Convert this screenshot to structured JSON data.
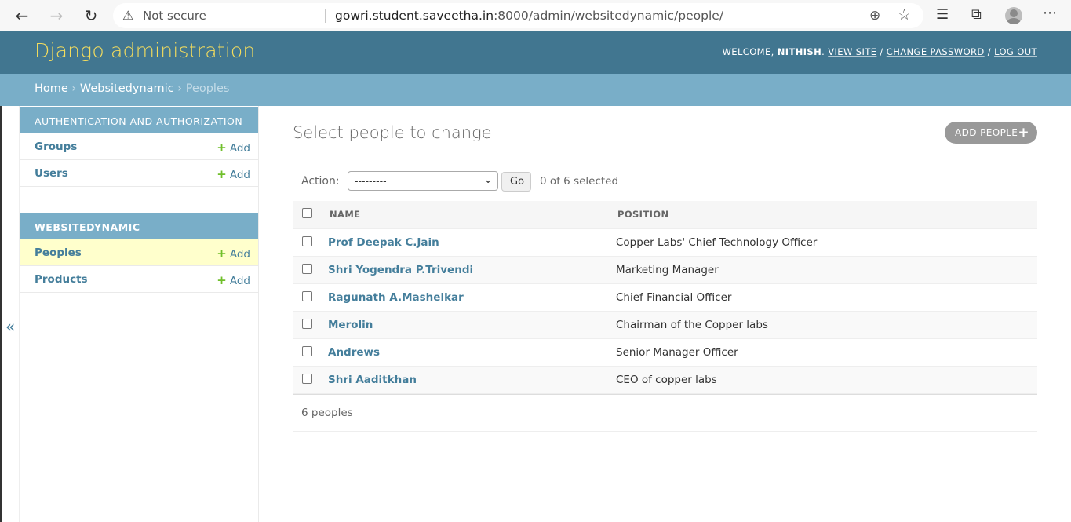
{
  "browser": {
    "security_label": "Not secure",
    "url_host": "gowri.student.saveetha.in",
    "url_rest": ":8000/admin/websitedynamic/people/"
  },
  "header": {
    "brand": "Django administration",
    "welcome": "WELCOME, ",
    "username": "NITHISH",
    "view_site": "VIEW SITE",
    "change_password": "CHANGE PASSWORD",
    "log_out": "LOG OUT"
  },
  "breadcrumbs": {
    "home": "Home",
    "app": "Websitedynamic",
    "current": "Peoples"
  },
  "sidebar": {
    "modules": [
      {
        "caption": "AUTHENTICATION AND AUTHORIZATION",
        "items": [
          {
            "label": "Groups",
            "add": "Add"
          },
          {
            "label": "Users",
            "add": "Add"
          }
        ]
      },
      {
        "caption": "WEBSITEDYNAMIC",
        "items": [
          {
            "label": "Peoples",
            "add": "Add"
          },
          {
            "label": "Products",
            "add": "Add"
          }
        ]
      }
    ],
    "toggle": "«"
  },
  "main": {
    "title": "Select people to change",
    "add_button": "ADD PEOPLE",
    "action_label": "Action:",
    "action_value": "---------",
    "go": "Go",
    "selected": "0 of 6 selected",
    "columns": [
      "NAME",
      "POSITION"
    ],
    "rows": [
      {
        "name": "Prof Deepak C.Jain",
        "position": "Copper Labs' Chief Technology Officer"
      },
      {
        "name": "Shri Yogendra P.Trivendi",
        "position": "Marketing Manager"
      },
      {
        "name": "Ragunath A.Mashelkar",
        "position": "Chief Financial Officer"
      },
      {
        "name": "Merolin",
        "position": "Chairman of the Copper labs"
      },
      {
        "name": "Andrews",
        "position": "Senior Manager Officer"
      },
      {
        "name": "Shri Aaditkhan",
        "position": "CEO of copper labs"
      }
    ],
    "count": "6 peoples"
  },
  "colors": {
    "header_bg": "#417690",
    "brand": "#f5dd5d",
    "breadcrumb_bg": "#79aec8",
    "link": "#447e9b",
    "add_green": "#70bf2b",
    "active_row": "#ffffcc"
  }
}
